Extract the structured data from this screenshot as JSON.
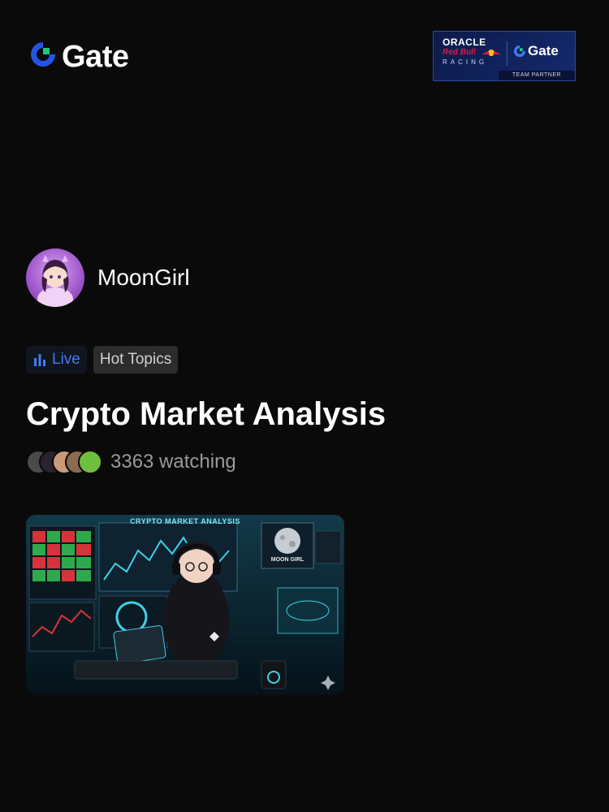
{
  "header": {
    "logo_text": "Gate",
    "partner_badge": {
      "oracle": "ORACLE",
      "red_bull": "Red Bull",
      "racing": "RACING",
      "gate": "Gate",
      "team_partner": "TEAM PARTNER"
    }
  },
  "host": {
    "name": "MoonGirl"
  },
  "tags": {
    "live": "Live",
    "topic": "Hot Topics"
  },
  "stream": {
    "title": "Crypto Market Analysis",
    "watching": "3363 watching"
  },
  "thumbnail": {
    "banner": "CRYPTO MARKET ANALYSIS",
    "badge": "MOON GIRL"
  },
  "colors": {
    "accent_blue": "#3d7cf5",
    "background": "#0a0a0a"
  }
}
